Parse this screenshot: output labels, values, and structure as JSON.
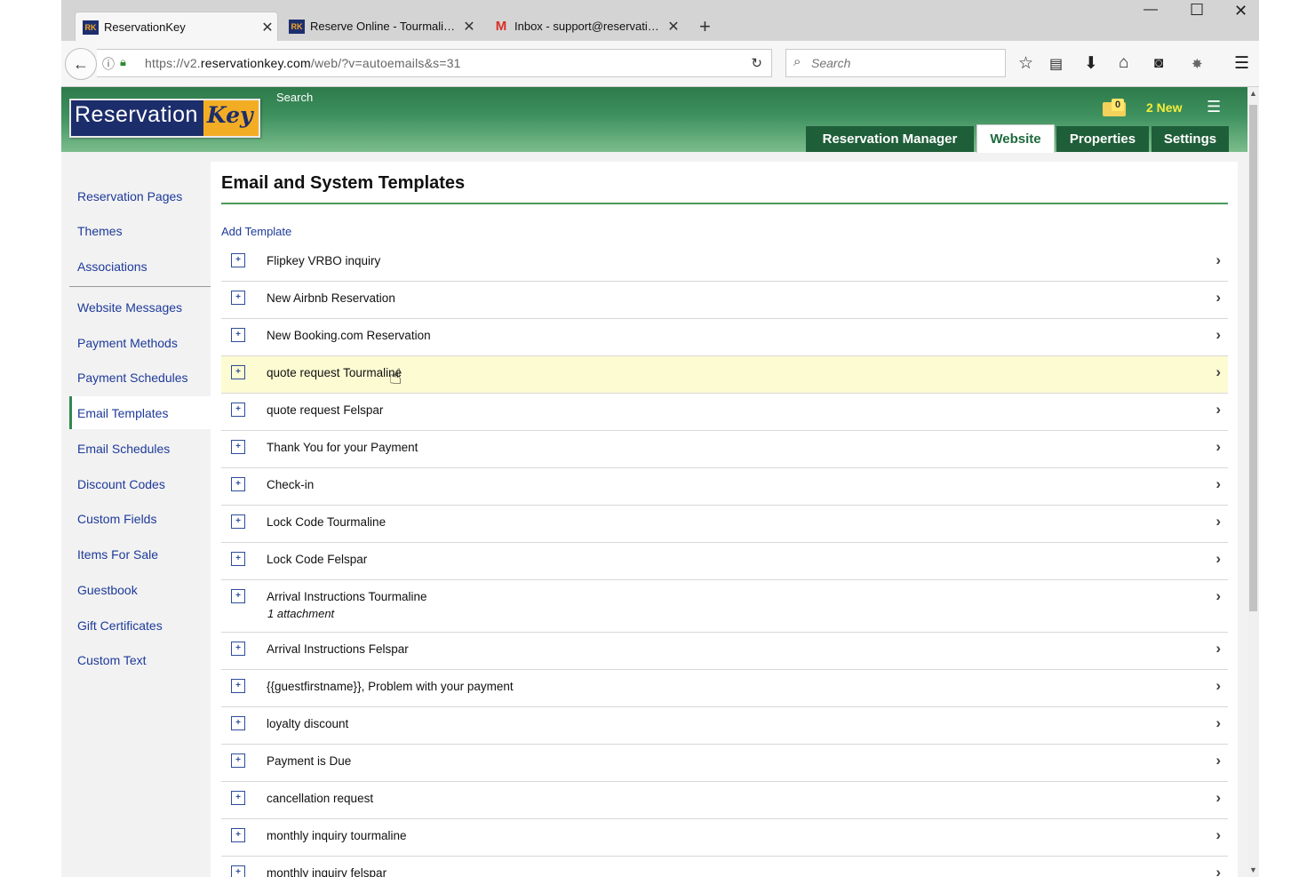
{
  "browser": {
    "tabs": [
      {
        "title": "ReservationKey",
        "icon": "reservationkey-icon",
        "active": true
      },
      {
        "title": "Reserve Online - Tourmali…",
        "icon": "reservationkey-icon",
        "active": false
      },
      {
        "title": "Inbox - support@reservati…",
        "icon": "gmail-icon",
        "active": false
      }
    ],
    "url_prefix": "https://v2.",
    "url_domain": "reservationkey.com",
    "url_path": "/web/?v=autoemails&s=31",
    "search_placeholder": "Search"
  },
  "header": {
    "logo_left": "Reservation",
    "logo_right": "Key",
    "search_link": "Search",
    "notification_count": "0",
    "new_count": "2 New",
    "nav": [
      {
        "label": "Reservation Manager",
        "active": false
      },
      {
        "label": "Website",
        "active": true
      },
      {
        "label": "Properties",
        "active": false
      },
      {
        "label": "Settings",
        "active": false
      }
    ]
  },
  "sidebar": {
    "items": [
      {
        "label": "Reservation Pages"
      },
      {
        "label": "Themes"
      },
      {
        "label": "Associations"
      },
      {
        "label": "Website Messages"
      },
      {
        "label": "Payment Methods"
      },
      {
        "label": "Payment Schedules"
      },
      {
        "label": "Email Templates",
        "active": true
      },
      {
        "label": "Email Schedules"
      },
      {
        "label": "Discount Codes"
      },
      {
        "label": "Custom Fields"
      },
      {
        "label": "Items For Sale"
      },
      {
        "label": "Guestbook"
      },
      {
        "label": "Gift Certificates"
      },
      {
        "label": "Custom Text"
      }
    ]
  },
  "main": {
    "title": "Email and System Templates",
    "add_template": "Add Template",
    "templates": [
      {
        "name": "Flipkey VRBO inquiry"
      },
      {
        "name": "New Airbnb Reservation"
      },
      {
        "name": "New Booking.com Reservation"
      },
      {
        "name": "quote request Tourmaline",
        "highlighted": true
      },
      {
        "name": "quote request Felspar"
      },
      {
        "name": "Thank You for your Payment"
      },
      {
        "name": "Check-in"
      },
      {
        "name": "Lock Code Tourmaline"
      },
      {
        "name": "Lock Code Felspar"
      },
      {
        "name": "Arrival Instructions Tourmaline",
        "note": "1 attachment"
      },
      {
        "name": "Arrival Instructions Felspar"
      },
      {
        "name": "{{guestfirstname}}, Problem with your payment"
      },
      {
        "name": "loyalty discount"
      },
      {
        "name": "Payment is Due"
      },
      {
        "name": "cancellation request"
      },
      {
        "name": "monthly inquiry tourmaline"
      },
      {
        "name": "monthly inquiry felspar"
      }
    ]
  },
  "colors": {
    "header_green": "#3f9160",
    "nav_dark_green": "#1e5e38",
    "link_blue": "#1e3a9a",
    "highlight_row": "#fdfbd2",
    "new_count_yellow": "#f5ed3a"
  }
}
